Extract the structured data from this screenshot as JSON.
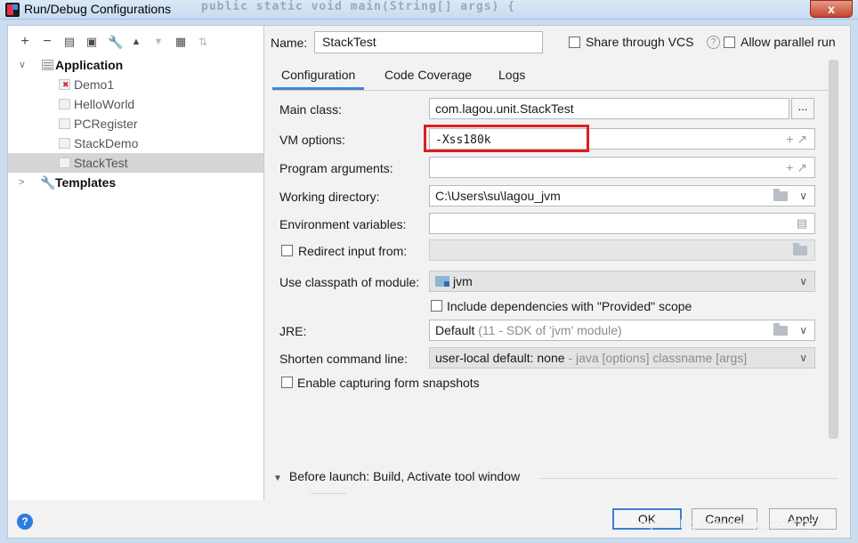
{
  "window": {
    "title": "Run/Debug Configurations",
    "background_code": "public static void main(String[] args) {",
    "close_label": "x"
  },
  "toolbar": {
    "icons": [
      "add-icon",
      "remove-icon",
      "copy-icon",
      "save-icon",
      "wrench-icon",
      "move-up-icon",
      "move-down-icon",
      "folder-icon",
      "sort-icon"
    ]
  },
  "tree": {
    "application_label": "Application",
    "items": [
      {
        "label": "Demo1",
        "error": true
      },
      {
        "label": "HelloWorld"
      },
      {
        "label": "PCRegister"
      },
      {
        "label": "StackDemo"
      },
      {
        "label": "StackTest",
        "selected": true
      }
    ],
    "templates_label": "Templates"
  },
  "header": {
    "name_label": "Name:",
    "name_value": "StackTest",
    "share_label": "Share through VCS",
    "parallel_label": "Allow parallel run"
  },
  "tabs": [
    "Configuration",
    "Code Coverage",
    "Logs"
  ],
  "form": {
    "main_class_label": "Main class:",
    "main_class_value": "com.lagou.unit.StackTest",
    "vm_options_label": "VM options:",
    "vm_options_value": "-Xss180k",
    "program_args_label": "Program arguments:",
    "program_args_value": "",
    "working_dir_label": "Working directory:",
    "working_dir_value": "C:\\Users\\su\\lagou_jvm",
    "env_vars_label": "Environment variables:",
    "env_vars_value": "",
    "redirect_label": "Redirect input from:",
    "classpath_label": "Use classpath of module:",
    "classpath_value": "jvm",
    "include_deps_label": "Include dependencies with \"Provided\" scope",
    "jre_label": "JRE:",
    "jre_value": "Default",
    "jre_note": "(11 - SDK of 'jvm' module)",
    "shorten_label": "Shorten command line:",
    "shorten_value": "user-local default: none",
    "shorten_note": "- java [options] classname [args]",
    "snapshots_label": "Enable capturing form snapshots"
  },
  "before_launch": {
    "label": "Before launch: Build, Activate tool window"
  },
  "buttons": {
    "ok": "OK",
    "cancel": "Cancel",
    "apply": "Apply"
  },
  "watermark": "https://blog.csdn.net/qq_42082278"
}
